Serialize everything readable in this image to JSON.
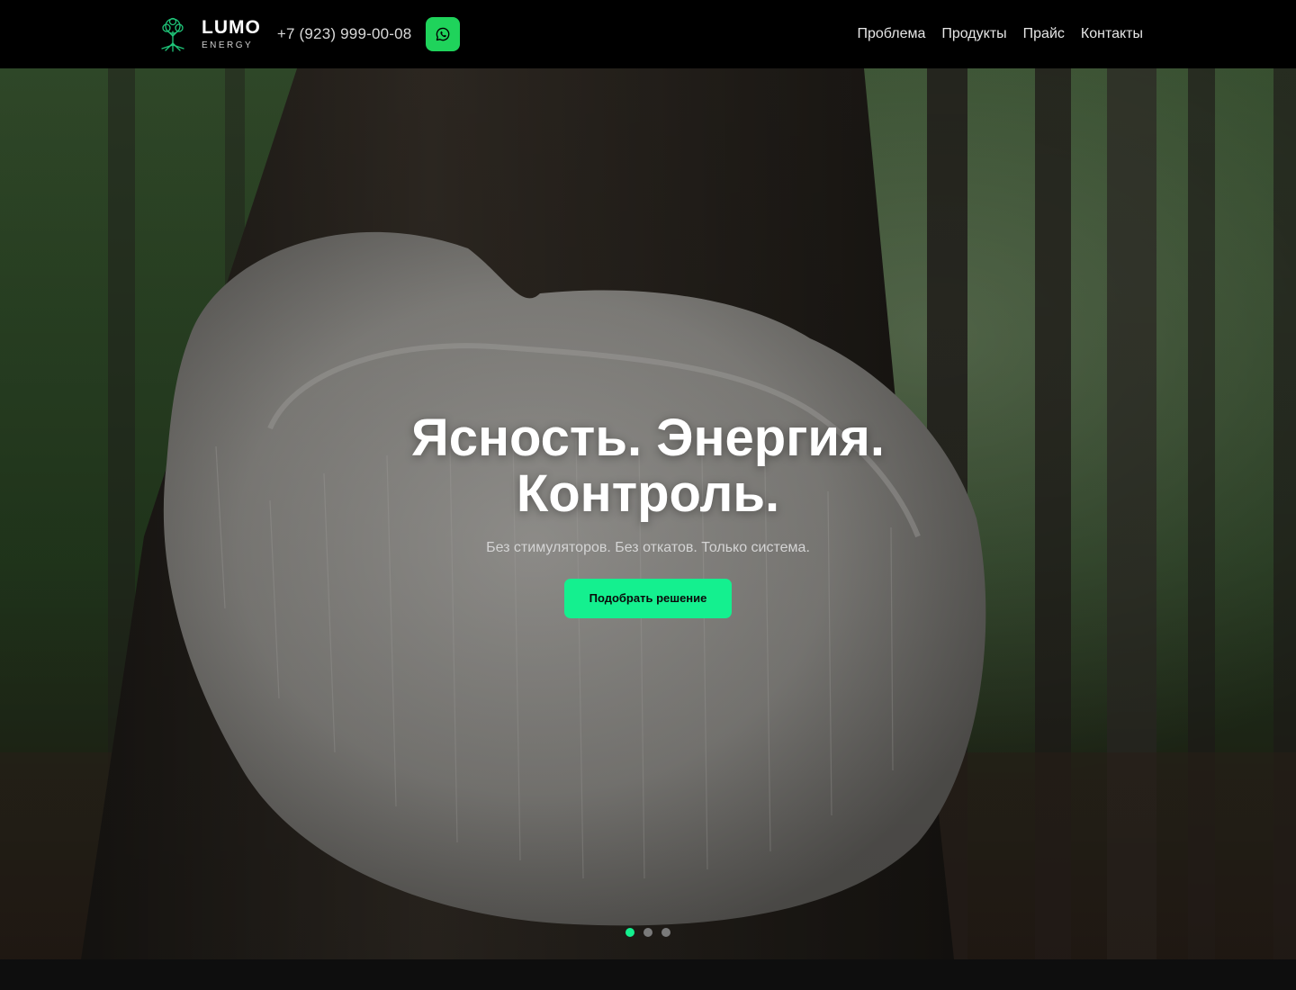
{
  "header": {
    "logo_title": "LUMO",
    "logo_subtitle": "ENERGY",
    "phone": "+7 (923) 999-00-08",
    "whatsapp_icon": "whatsapp-icon",
    "nav": [
      {
        "label": "Проблема"
      },
      {
        "label": "Продукты"
      },
      {
        "label": "Прайс"
      },
      {
        "label": "Контакты"
      }
    ]
  },
  "hero": {
    "headline_line1": "Ясность. Энергия.",
    "headline_line2": "Контроль.",
    "subline": "Без стимуляторов. Без откатов. Только система.",
    "cta_label": "Подобрать решение",
    "slides_total": 3,
    "active_slide": 1
  },
  "colors": {
    "accent": "#14f08f",
    "whatsapp": "#1fd35b",
    "header_bg": "#000000"
  }
}
